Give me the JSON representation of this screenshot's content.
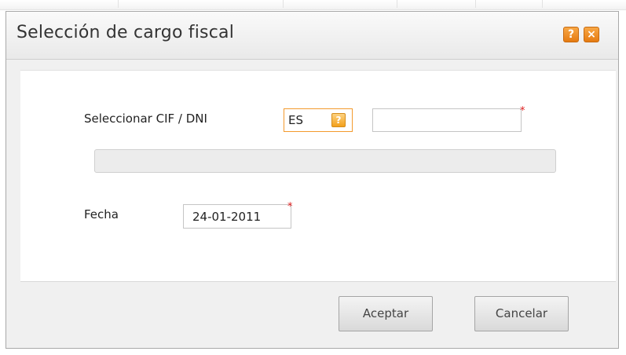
{
  "dialog": {
    "title": "Selección de cargo fiscal",
    "help_glyph": "?",
    "close_glyph": "×"
  },
  "form": {
    "cif_label": "Seleccionar CIF / DNI",
    "country_code": "ES",
    "country_help_glyph": "?",
    "cif_value": "",
    "info_text": "",
    "date_label": "Fecha",
    "date_value": "24-01-2011",
    "required_marker": "*"
  },
  "buttons": {
    "accept": "Aceptar",
    "cancel": "Cancelar"
  },
  "colors": {
    "accent_orange": "#f39a2d",
    "required_red": "#e02020"
  },
  "icons": {
    "help": "question-mark-icon",
    "close": "close-icon"
  }
}
